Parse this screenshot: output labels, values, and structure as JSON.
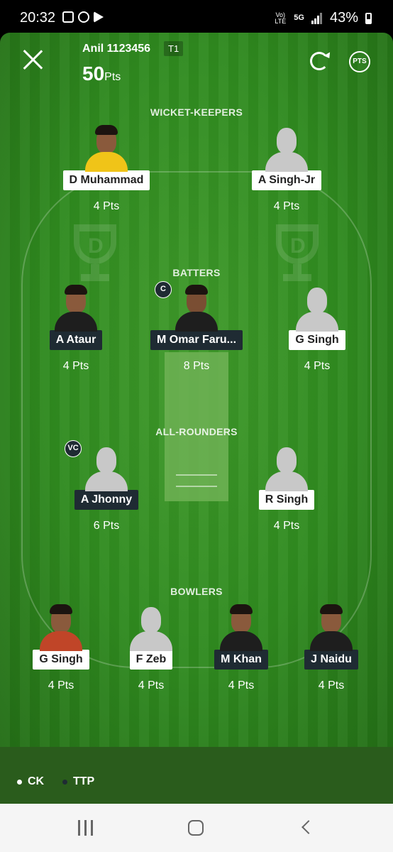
{
  "status_bar": {
    "time": "20:32",
    "net_top": "Vo) LTE",
    "net_5g": "5G",
    "battery": "43%"
  },
  "header": {
    "team_name": "Anil 1123456",
    "team_tag": "T1",
    "points_value": "50",
    "points_unit": "Pts",
    "pts_button": "PTS"
  },
  "sections": {
    "wicket_keepers": "WICKET-KEEPERS",
    "batters": "BATTERS",
    "all_rounders": "ALL-ROUNDERS",
    "bowlers": "BOWLERS"
  },
  "players": {
    "wk1": {
      "name": "D Muhammad",
      "points": "4 Pts"
    },
    "wk2": {
      "name": "A Singh-Jr",
      "points": "4 Pts"
    },
    "bat1": {
      "name": "A Ataur",
      "points": "4 Pts"
    },
    "bat2": {
      "name": "M Omar Faru...",
      "points": "8 Pts",
      "badge": "C"
    },
    "bat3": {
      "name": "G Singh",
      "points": "4 Pts"
    },
    "ar1": {
      "name": "A Jhonny",
      "points": "6 Pts",
      "badge": "VC"
    },
    "ar2": {
      "name": "R Singh",
      "points": "4 Pts"
    },
    "bowl1": {
      "name": "G Singh",
      "points": "4 Pts"
    },
    "bowl2": {
      "name": "F Zeb",
      "points": "4 Pts"
    },
    "bowl3": {
      "name": "M Khan",
      "points": "4 Pts"
    },
    "bowl4": {
      "name": "J Naidu",
      "points": "4 Pts"
    }
  },
  "legend": {
    "ck": {
      "label": "CK",
      "color": "#ffffff"
    },
    "ttp": {
      "label": "TTP",
      "color": "#1f2b33"
    }
  },
  "colors": {
    "field": "#2f8a1f",
    "dark_label": "#1f2b33"
  }
}
